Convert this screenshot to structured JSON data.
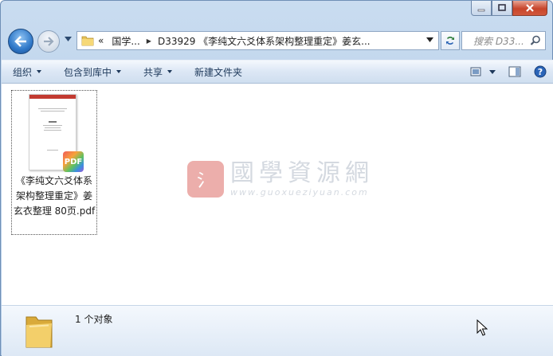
{
  "address": {
    "overflow": "«",
    "segments": [
      "国学...",
      "D33929 《李纯文六爻体系架构整理重定》姜玄..."
    ]
  },
  "search": {
    "placeholder": "搜索 D33..."
  },
  "toolbar": {
    "organize": "组织",
    "include_in_library": "包含到库中",
    "share": "共享",
    "new_folder": "新建文件夹"
  },
  "file": {
    "name": "《李纯文六爻体系架构整理重定》姜玄衣整理 80页.pdf",
    "badge": "PDF",
    "thumb_header": "PDF"
  },
  "watermark": {
    "logo_char": "氵",
    "title": "國學資源網",
    "url": "www.guoxueziyuan.com"
  },
  "details": {
    "count": "1 个对象"
  },
  "colors": {
    "accent": "#2f78c8",
    "close": "#c7452b"
  }
}
